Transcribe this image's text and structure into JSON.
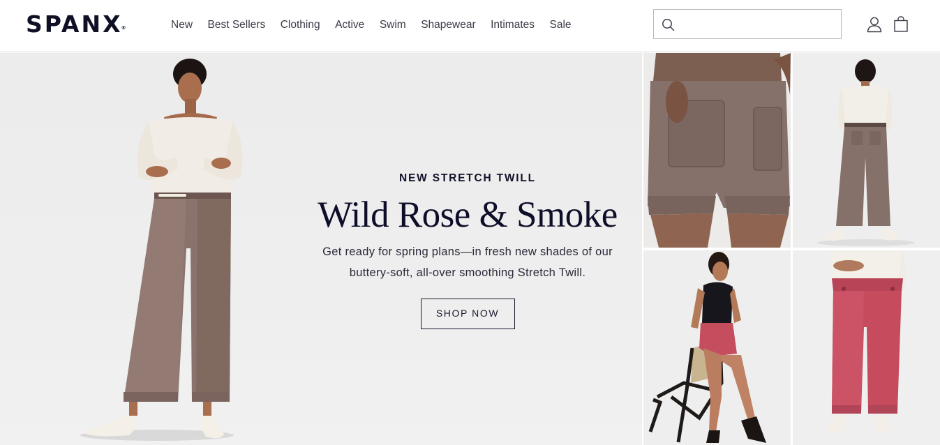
{
  "brand": {
    "logo_text": "SPANX",
    "registered_mark": "®"
  },
  "nav": {
    "items": [
      "New",
      "Best Sellers",
      "Clothing",
      "Active",
      "Swim",
      "Shapewear",
      "Intimates",
      "Sale"
    ]
  },
  "search": {
    "placeholder": "",
    "value": "",
    "icon": "search-icon"
  },
  "header_icons": {
    "account": "user-icon",
    "bag": "shopping-bag-icon"
  },
  "hero": {
    "eyebrow": "NEW STRETCH TWILL",
    "headline": "Wild Rose & Smoke",
    "subcopy_line1": "Get ready for spring plans—in fresh new shades of our",
    "subcopy_line2": "buttery-soft, all-over smoothing Stretch Twill.",
    "cta_label": "SHOP NOW"
  },
  "colors": {
    "brand_navy": "#0f1026",
    "smoke": "#8e7670",
    "wild_rose": "#c24a5a",
    "hero_bg": "#ececec"
  }
}
